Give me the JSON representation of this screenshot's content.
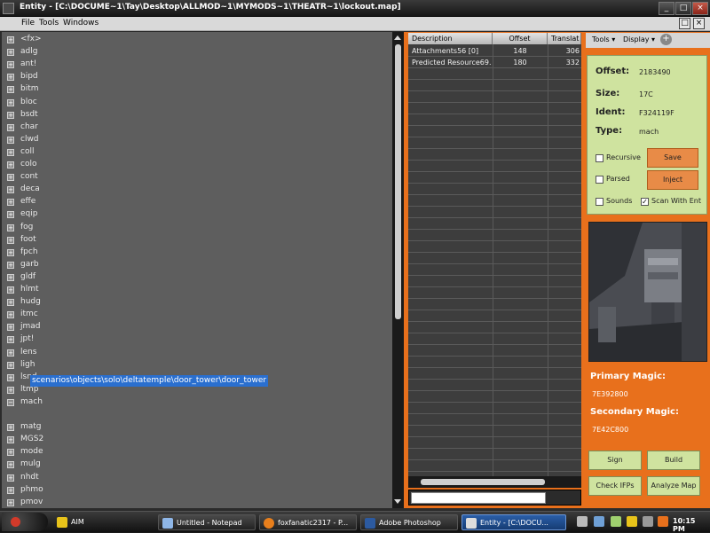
{
  "window": {
    "title": "Entity - [C:\\DOCUME~1\\Tay\\Desktop\\ALLMOD~1\\MYMODS~1\\THEATR~1\\lockout.map]",
    "minimize": "_",
    "maximize": "□",
    "close": "×"
  },
  "menu": {
    "items": [
      "File",
      "Tools",
      "Windows"
    ],
    "mdi_restore": "□",
    "mdi_close": "×"
  },
  "tree": {
    "items": [
      "<fx>",
      "adlg",
      "ant!",
      "bipd",
      "bitm",
      "bloc",
      "bsdt",
      "char",
      "clwd",
      "coll",
      "colo",
      "cont",
      "deca",
      "effe",
      "eqip",
      "fog",
      "foot",
      "fpch",
      "garb",
      "gldf",
      "hlmt",
      "hudg",
      "itmc",
      "jmad",
      "jpt!",
      "lens",
      "ligh",
      "lsnd",
      "ltmp",
      "mach"
    ],
    "expanded_child": "scenarios\\objects\\solo\\deltatemple\\door_tower\\door_tower",
    "items_after": [
      "matg",
      "MGS2",
      "mode",
      "mulg",
      "nhdt",
      "phmo",
      "pmov"
    ],
    "plus": "+",
    "minus": "−"
  },
  "grid": {
    "headers": [
      "Description",
      "Offset",
      "Translat"
    ],
    "rows": [
      [
        "Attachments56 [0]",
        "148",
        "306"
      ],
      [
        "Predicted Resource69...",
        "180",
        "332"
      ]
    ]
  },
  "toolbar": {
    "tools": "Tools ▾",
    "display": "Display ▾"
  },
  "info": {
    "offset_label": "Offset:",
    "offset_value": "2183490",
    "size_label": "Size:",
    "size_value": "17C",
    "ident_label": "Ident:",
    "ident_value": "F324119F",
    "type_label": "Type:",
    "type_value": "mach",
    "recursive": "Recursive",
    "parsed": "Parsed",
    "sounds": "Sounds",
    "scan_with_ent": "Scan With Ent",
    "scan_checked": true,
    "save": "Save",
    "inject": "Inject"
  },
  "magic": {
    "primary_label": "Primary Magic:",
    "primary_value": "7E392800",
    "secondary_label": "Secondary Magic:",
    "secondary_value": "7E42C800"
  },
  "buttons": {
    "sign": "Sign",
    "build": "Build",
    "check_ifps": "Check IFPs",
    "analyze_map": "Analyze Map"
  },
  "taskbar": {
    "aim": "AIM",
    "tasks": [
      "Untitled - Notepad",
      "foxfanatic2317 - P...",
      "Adobe Photoshop",
      "Entity - [C:\\DOCU..."
    ],
    "clock": "10:15 PM"
  },
  "colors": {
    "accent_orange": "#E8701C",
    "panel_green": "#CFE39F",
    "button_orange": "#E88B47",
    "selection_blue": "#2A6FCF"
  }
}
